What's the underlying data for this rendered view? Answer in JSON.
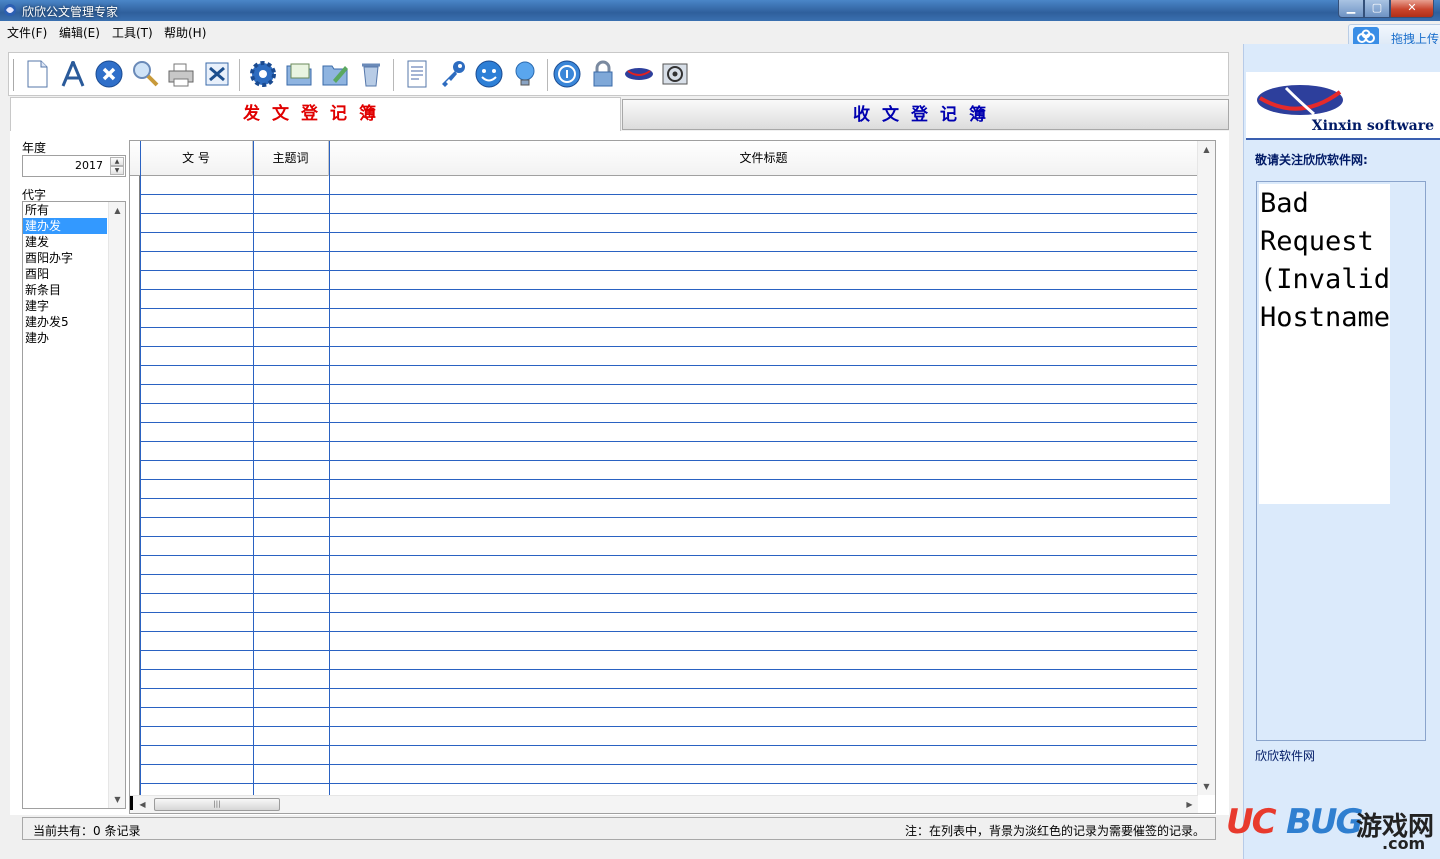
{
  "window": {
    "title": "欣欣公文管理专家",
    "min_label": "▁",
    "max_label": "▢",
    "close_label": "✕"
  },
  "menu": [
    {
      "label": "文件(F)"
    },
    {
      "label": "编辑(E)"
    },
    {
      "label": "工具(T)"
    },
    {
      "label": "帮助(H)"
    }
  ],
  "cloud": {
    "label": "拖拽上传"
  },
  "toolbar": {
    "buttons": [
      {
        "icon": "new-document-icon"
      },
      {
        "icon": "compass-icon"
      },
      {
        "icon": "delete-icon"
      },
      {
        "icon": "search-icon"
      },
      {
        "icon": "printer-icon"
      },
      {
        "icon": "excel-export-icon"
      },
      {
        "icon": "gear-icon"
      },
      {
        "icon": "open-folder-icon"
      },
      {
        "icon": "folder-edit-icon"
      },
      {
        "icon": "trash-icon"
      },
      {
        "icon": "report-icon"
      },
      {
        "icon": "key-icon"
      },
      {
        "icon": "smiley-icon"
      },
      {
        "icon": "lightbulb-icon"
      },
      {
        "icon": "info-icon"
      },
      {
        "icon": "lock-icon"
      },
      {
        "icon": "xinxin-logo-icon"
      },
      {
        "icon": "email-icon"
      }
    ]
  },
  "tabs": {
    "outgoing": "发文登记簿",
    "incoming": "收文登记簿"
  },
  "filters": {
    "year_label": "年度",
    "year_value": "2017",
    "daizi_label": "代字",
    "daizi_items": [
      "所有",
      "建办发",
      "建发",
      "酉阳办字",
      "酉阳",
      "新条目",
      "建字",
      "建办发5",
      "建办"
    ],
    "selected_index": 1
  },
  "grid": {
    "columns": [
      "文  号",
      "主题词",
      "文件标题"
    ],
    "rows": []
  },
  "status": {
    "left": "当前共有：0 条记录",
    "right": "注：在列表中，背景为淡红色的记录为需要催签的记录。"
  },
  "ad": {
    "brand": "Xinxin software",
    "follow": "敬请关注欣欣软件网:",
    "webview_text": [
      "Bad",
      "Request",
      "(Invalid",
      "Hostname"
    ],
    "site_link": "欣欣软件网"
  },
  "watermark": {
    "uc": "UC",
    "bug": "BUG",
    "cn": "游戏网",
    "com": ".com"
  },
  "colors": {
    "grid_line": "#2a62c2",
    "active_tab_text": "#e00000",
    "inactive_tab_text": "#0000b0",
    "selection": "#3399ff"
  }
}
